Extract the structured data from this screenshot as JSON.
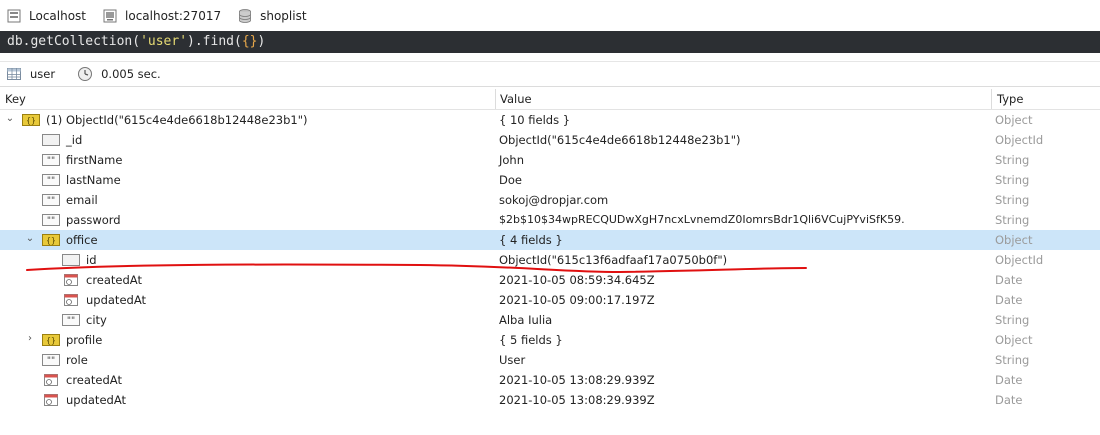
{
  "connection": {
    "server_label": "Localhost",
    "host_label": "localhost:27017",
    "db_label": "shoplist"
  },
  "query": {
    "prefix": "db.getCollection(",
    "collection": "'user'",
    "mid": ").find(",
    "args": "{}",
    "suffix": ")"
  },
  "status": {
    "collection": "user",
    "time": "0.005 sec."
  },
  "columns": {
    "key": "Key",
    "value": "Value",
    "type": "Type"
  },
  "rows": [
    {
      "key": "(1) ObjectId(\"615c4e4de6618b12448e23b1\")",
      "value": "{ 10 fields }",
      "type": "Object",
      "icon": "object-icon",
      "expanded": true
    },
    {
      "key": "_id",
      "value": "ObjectId(\"615c4e4de6618b12448e23b1\")",
      "type": "ObjectId",
      "icon": "objectid-icon"
    },
    {
      "key": "firstName",
      "value": "John",
      "type": "String",
      "icon": "string-icon"
    },
    {
      "key": "lastName",
      "value": "Doe",
      "type": "String",
      "icon": "string-icon"
    },
    {
      "key": "email",
      "value": "sokoj@dropjar.com",
      "type": "String",
      "icon": "string-icon"
    },
    {
      "key": "password",
      "value": "$2b$10$34wpRECQUDwXgH7ncxLvnemdZ0IomrsBdr1Qli6VCujPYviSfK59.",
      "type": "String",
      "icon": "string-icon"
    },
    {
      "key": "office",
      "value": "{ 4 fields }",
      "type": "Object",
      "icon": "object-icon",
      "expanded": true,
      "selected": true
    },
    {
      "key": "id",
      "value": "ObjectId(\"615c13f6adfaaf17a0750b0f\")",
      "type": "ObjectId",
      "icon": "objectid-icon"
    },
    {
      "key": "createdAt",
      "value": "2021-10-05 08:59:34.645Z",
      "type": "Date",
      "icon": "date-icon"
    },
    {
      "key": "updatedAt",
      "value": "2021-10-05 09:00:17.197Z",
      "type": "Date",
      "icon": "date-icon"
    },
    {
      "key": "city",
      "value": "Alba Iulia",
      "type": "String",
      "icon": "string-icon"
    },
    {
      "key": "profile",
      "value": "{ 5 fields }",
      "type": "Object",
      "icon": "object-icon",
      "collapsed": true
    },
    {
      "key": "role",
      "value": "User",
      "type": "String",
      "icon": "string-icon"
    },
    {
      "key": "createdAt",
      "value": "2021-10-05 13:08:29.939Z",
      "type": "Date",
      "icon": "date-icon"
    },
    {
      "key": "updatedAt",
      "value": "2021-10-05 13:08:29.939Z",
      "type": "Date",
      "icon": "date-icon"
    }
  ],
  "colors": {
    "query_bg": "#2c2f33",
    "selection": "#cce5f9",
    "annotation_red": "#e01010",
    "object_icon": "#e8c93a",
    "date_icon": "#d9534f"
  }
}
